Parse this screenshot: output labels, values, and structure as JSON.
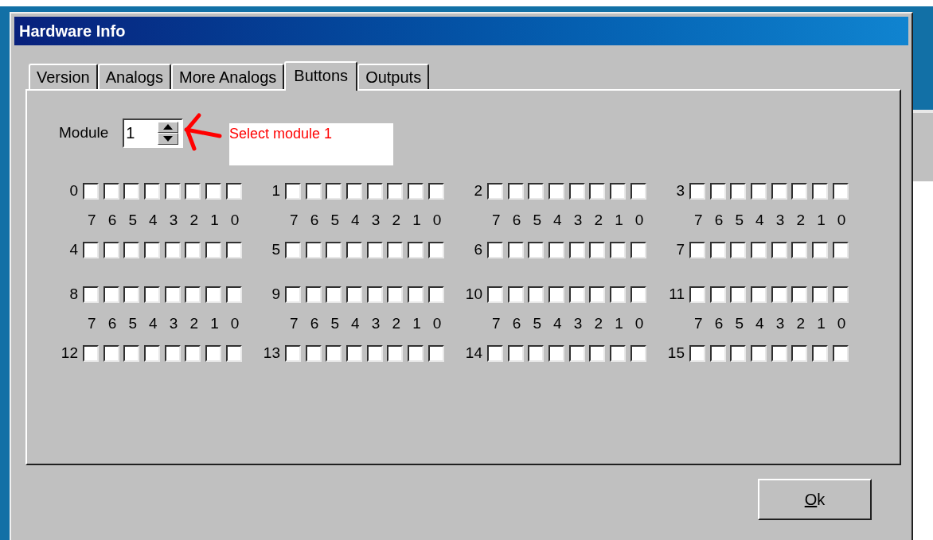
{
  "window": {
    "title": "Hardware Info"
  },
  "tabs": [
    {
      "label": "Version",
      "selected": false
    },
    {
      "label": "Analogs",
      "selected": false
    },
    {
      "label": "More Analogs",
      "selected": false
    },
    {
      "label": "Buttons",
      "selected": true
    },
    {
      "label": "Outputs",
      "selected": false
    }
  ],
  "module": {
    "label": "Module",
    "value": "1"
  },
  "annotation": {
    "text": "Select module 1"
  },
  "banks": [
    {
      "top_groups": [
        {
          "label": "0",
          "bits": [
            false,
            false,
            false,
            false,
            false,
            false,
            false,
            false
          ]
        },
        {
          "label": "1",
          "bits": [
            false,
            false,
            false,
            false,
            false,
            false,
            false,
            false
          ]
        },
        {
          "label": "2",
          "bits": [
            false,
            false,
            false,
            false,
            false,
            false,
            false,
            false
          ]
        },
        {
          "label": "3",
          "bits": [
            false,
            false,
            false,
            false,
            false,
            false,
            false,
            false
          ]
        }
      ],
      "bit_labels": [
        [
          "7",
          "6",
          "5",
          "4",
          "3",
          "2",
          "1",
          "0"
        ],
        [
          "7",
          "6",
          "5",
          "4",
          "3",
          "2",
          "1",
          "0"
        ],
        [
          "7",
          "6",
          "5",
          "4",
          "3",
          "2",
          "1",
          "0"
        ],
        [
          "7",
          "6",
          "5",
          "4",
          "3",
          "2",
          "1",
          "0"
        ]
      ],
      "bottom_groups": [
        {
          "label": "4",
          "bits": [
            false,
            false,
            false,
            false,
            false,
            false,
            false,
            false
          ]
        },
        {
          "label": "5",
          "bits": [
            false,
            false,
            false,
            false,
            false,
            false,
            false,
            false
          ]
        },
        {
          "label": "6",
          "bits": [
            false,
            false,
            false,
            false,
            false,
            false,
            false,
            false
          ]
        },
        {
          "label": "7",
          "bits": [
            false,
            false,
            false,
            false,
            false,
            false,
            false,
            false
          ]
        }
      ]
    },
    {
      "top_groups": [
        {
          "label": "8",
          "bits": [
            false,
            false,
            false,
            false,
            false,
            false,
            false,
            false
          ]
        },
        {
          "label": "9",
          "bits": [
            false,
            false,
            false,
            false,
            false,
            false,
            false,
            false
          ]
        },
        {
          "label": "10",
          "bits": [
            false,
            false,
            false,
            false,
            false,
            false,
            false,
            false
          ]
        },
        {
          "label": "11",
          "bits": [
            false,
            false,
            false,
            false,
            false,
            false,
            false,
            false
          ]
        }
      ],
      "bit_labels": [
        [
          "7",
          "6",
          "5",
          "4",
          "3",
          "2",
          "1",
          "0"
        ],
        [
          "7",
          "6",
          "5",
          "4",
          "3",
          "2",
          "1",
          "0"
        ],
        [
          "7",
          "6",
          "5",
          "4",
          "3",
          "2",
          "1",
          "0"
        ],
        [
          "7",
          "6",
          "5",
          "4",
          "3",
          "2",
          "1",
          "0"
        ]
      ],
      "bottom_groups": [
        {
          "label": "12",
          "bits": [
            false,
            false,
            false,
            false,
            false,
            false,
            false,
            false
          ]
        },
        {
          "label": "13",
          "bits": [
            false,
            false,
            false,
            false,
            false,
            false,
            false,
            false
          ]
        },
        {
          "label": "14",
          "bits": [
            false,
            false,
            false,
            false,
            false,
            false,
            false,
            false
          ]
        },
        {
          "label": "15",
          "bits": [
            false,
            false,
            false,
            false,
            false,
            false,
            false,
            false
          ]
        }
      ]
    }
  ],
  "ok_button": {
    "label": "Ok",
    "mnemonic": true
  }
}
